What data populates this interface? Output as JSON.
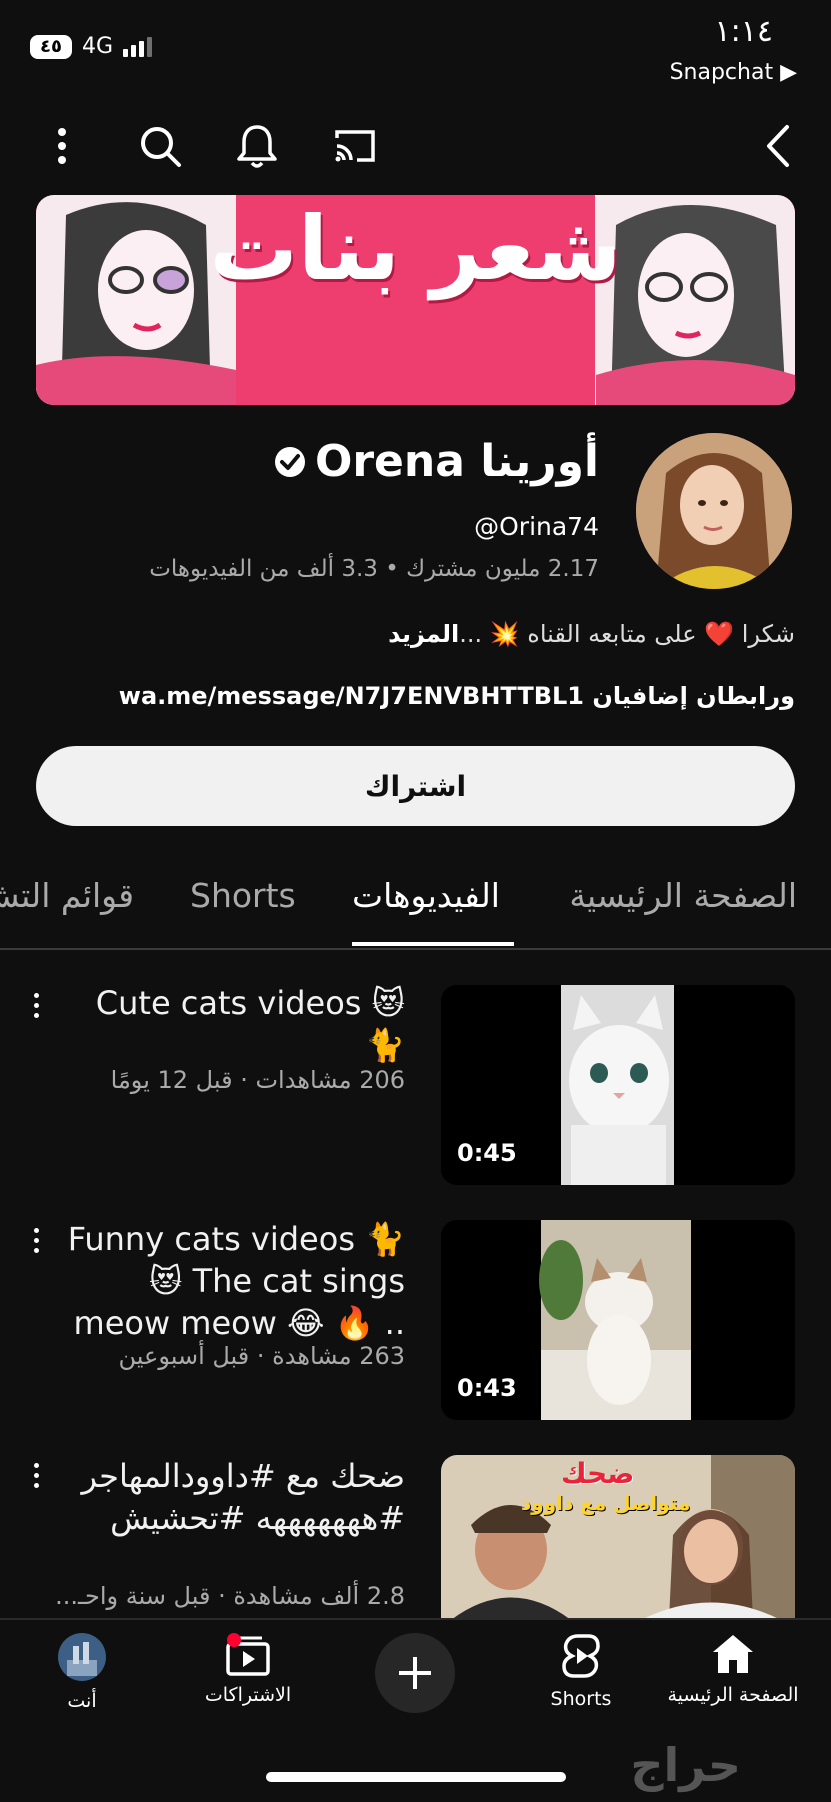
{
  "status_bar": {
    "time": "١:١٤",
    "back_app": "Snapchat ▶",
    "battery": "٤٥",
    "network": "4G"
  },
  "banner": {
    "title": "شعر بنات"
  },
  "channel": {
    "name": "Orena أورينا",
    "handle": "@Orina74",
    "stats": "2.17 مليون مشترك • 3.3 ألف من الفيديوهات",
    "description": "شكرا ❤️ على متابعه القناه 💥 ...",
    "description_more": "المزيد",
    "links": "wa.me/message/N7J7ENVBHTTBL1 ورابطان إضافيان",
    "subscribe_label": "اشتراك"
  },
  "tabs": [
    {
      "label": "الصفحة الرئيسية",
      "active": false
    },
    {
      "label": "الفيديوهات",
      "active": true
    },
    {
      "label": "Shorts",
      "active": false
    },
    {
      "label": "قوائم التش",
      "active": false
    }
  ],
  "videos": [
    {
      "title": "Cute cats videos 😻 🐈",
      "meta": "206 مشاهدات · قبل 12 يومًا",
      "duration": "0:45"
    },
    {
      "title": "Funny cats videos 🐈 😻 The cat sings meow meow 😂 🔥 ..",
      "meta": "263 مشاهدة · قبل أسبوعين",
      "duration": "0:43"
    },
    {
      "title": "ضحك مع #داوودالمهاجر #هههههههه #تحشيش",
      "meta": "2.8 ألف مشاهدة · قبل سنة واحـ...",
      "thumb_text_1": "ضحك",
      "thumb_text_2": "متواصل مع داوود"
    }
  ],
  "bottom_nav": {
    "home": "الصفحة الرئيسية",
    "shorts": "Shorts",
    "subscriptions": "الاشتراكات",
    "you": "أنت"
  },
  "watermark": "حراج",
  "colors": {
    "background": "#0f0f0f",
    "accent_red": "#ff0033",
    "banner_pink": "#ee3d6f"
  }
}
